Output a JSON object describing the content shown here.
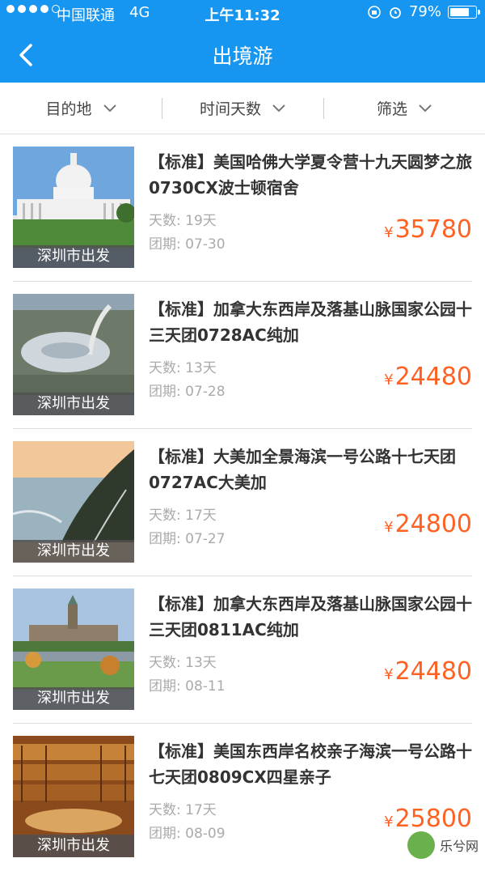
{
  "status": {
    "carrier": "中国联通",
    "network": "4G",
    "time": "上午11:32",
    "battery": "79%",
    "battery_level": 0.79
  },
  "nav": {
    "title": "出境游"
  },
  "filters": [
    {
      "label": "目的地"
    },
    {
      "label": "时间天数"
    },
    {
      "label": "筛选"
    }
  ],
  "labels": {
    "days": "天数: ",
    "tour_date": "团期: ",
    "currency": "¥"
  },
  "tours": [
    {
      "name": "【标准】美国哈佛大学夏令营十九天圆梦之旅0730CX波士顿宿舍",
      "days": "19天",
      "date": "07-30",
      "price": "35780",
      "departure": "深圳市出发",
      "image": "capitol-building"
    },
    {
      "name": "【标准】加拿大东西岸及落基山脉国家公园十三天团0728AC纯加",
      "days": "13天",
      "date": "07-28",
      "price": "24480",
      "departure": "深圳市出发",
      "image": "olympic-stadium"
    },
    {
      "name": "【标准】大美加全景海滨一号公路十七天团0727AC大美加",
      "days": "17天",
      "date": "07-27",
      "price": "24800",
      "departure": "深圳市出发",
      "image": "coastal-highway"
    },
    {
      "name": "【标准】加拿大东西岸及落基山脉国家公园十三天团0811AC纯加",
      "days": "13天",
      "date": "08-11",
      "price": "24480",
      "departure": "深圳市出发",
      "image": "parliament-hill"
    },
    {
      "name": "【标准】美国东西岸名校亲子海滨一号公路十七天团0809CX四星亲子",
      "days": "17天",
      "date": "08-09",
      "price": "25800",
      "departure": "深圳市出发",
      "image": "library-hall"
    }
  ],
  "watermark": {
    "text": "乐兮网"
  }
}
